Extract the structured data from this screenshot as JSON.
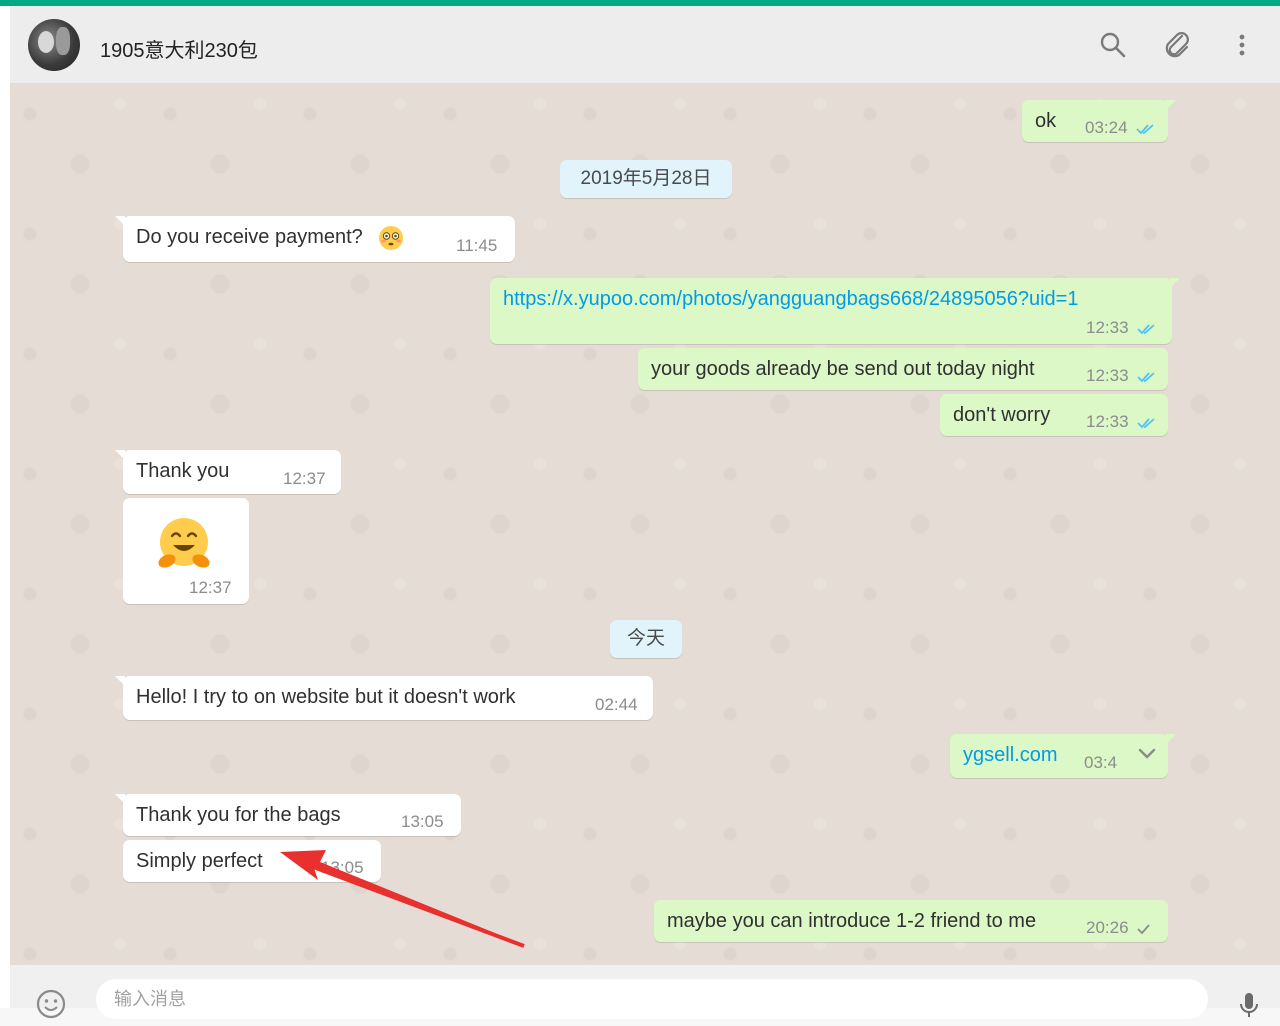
{
  "header": {
    "chat_title": "1905意大利230包",
    "icons": [
      "search-icon",
      "paperclip-icon",
      "more-vertical-icon"
    ]
  },
  "messages": {
    "m1": {
      "text": "ok",
      "time": "03:24",
      "dir": "out",
      "status": "read"
    },
    "date1": "2019年5月28日",
    "m2": {
      "text": "Do you receive payment?",
      "emoji": "flushed-face-emoji",
      "time": "11:45",
      "dir": "in"
    },
    "m3": {
      "text": "https://x.yupoo.com/photos/yangguangbags668/24895056?uid=1",
      "time": "12:33",
      "dir": "out",
      "status": "read"
    },
    "m4": {
      "text": "your goods already be send out today night",
      "time": "12:33",
      "dir": "out",
      "status": "read"
    },
    "m5": {
      "text": "don't worry",
      "time": "12:33",
      "dir": "out",
      "status": "read"
    },
    "m6": {
      "text": "Thank you",
      "time": "12:37",
      "dir": "in"
    },
    "m7": {
      "emoji": "hugging-face-emoji",
      "time": "12:37",
      "dir": "in"
    },
    "date2": "今天",
    "m8": {
      "text": "Hello! I try to on website but it doesn't work",
      "time": "02:44",
      "dir": "in"
    },
    "m9": {
      "text": "ygsell.com",
      "time": "03:4",
      "dir": "out"
    },
    "m10": {
      "text": "Thank you for the bags",
      "time": "13:05",
      "dir": "in"
    },
    "m11": {
      "text": "Simply perfect",
      "time": "13:05",
      "dir": "in"
    },
    "m12": {
      "text": "maybe you can introduce 1-2 friend to me",
      "time": "20:26",
      "dir": "out",
      "status": "delivered"
    }
  },
  "annotation": {
    "type": "red-arrow",
    "points_to": "m11"
  },
  "footer": {
    "input_placeholder": "输入消息",
    "icons": [
      "emoji-icon",
      "microphone-icon"
    ]
  },
  "colors": {
    "accent": "#00a884",
    "incoming_bubble": "#ffffff",
    "outgoing_bubble": "#dcf8c6",
    "chat_background": "#e5ddd5",
    "read_tick": "#4fc3f7",
    "link": "#039be5",
    "arrow": "#e8312e"
  }
}
